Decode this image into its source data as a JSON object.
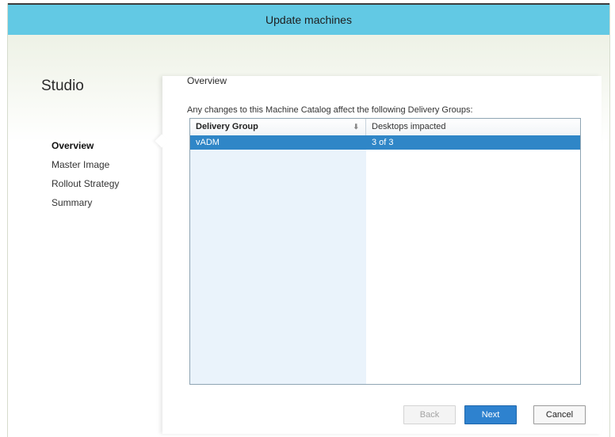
{
  "window": {
    "title": "Update machines"
  },
  "sidebar": {
    "app_name": "Studio",
    "items": [
      {
        "label": "Overview",
        "active": true
      },
      {
        "label": "Master Image",
        "active": false
      },
      {
        "label": "Rollout Strategy",
        "active": false
      },
      {
        "label": "Summary",
        "active": false
      }
    ]
  },
  "main": {
    "section_title": "Overview",
    "description": "Any changes to this Machine Catalog affect the following Delivery Groups:",
    "table": {
      "columns": [
        "Delivery Group",
        "Desktops impacted"
      ],
      "sort_icon": "sort-down-icon",
      "rows": [
        {
          "delivery_group": "vADM",
          "desktops_impacted": "3 of 3",
          "selected": true
        }
      ]
    }
  },
  "footer": {
    "back_label": "Back",
    "back_enabled": false,
    "next_label": "Next",
    "cancel_label": "Cancel"
  },
  "colors": {
    "titlebar": "#62c9e4",
    "selection": "#2f86c7",
    "primary_button": "#2e82cf",
    "first_column_bg": "#eaf3fb"
  }
}
